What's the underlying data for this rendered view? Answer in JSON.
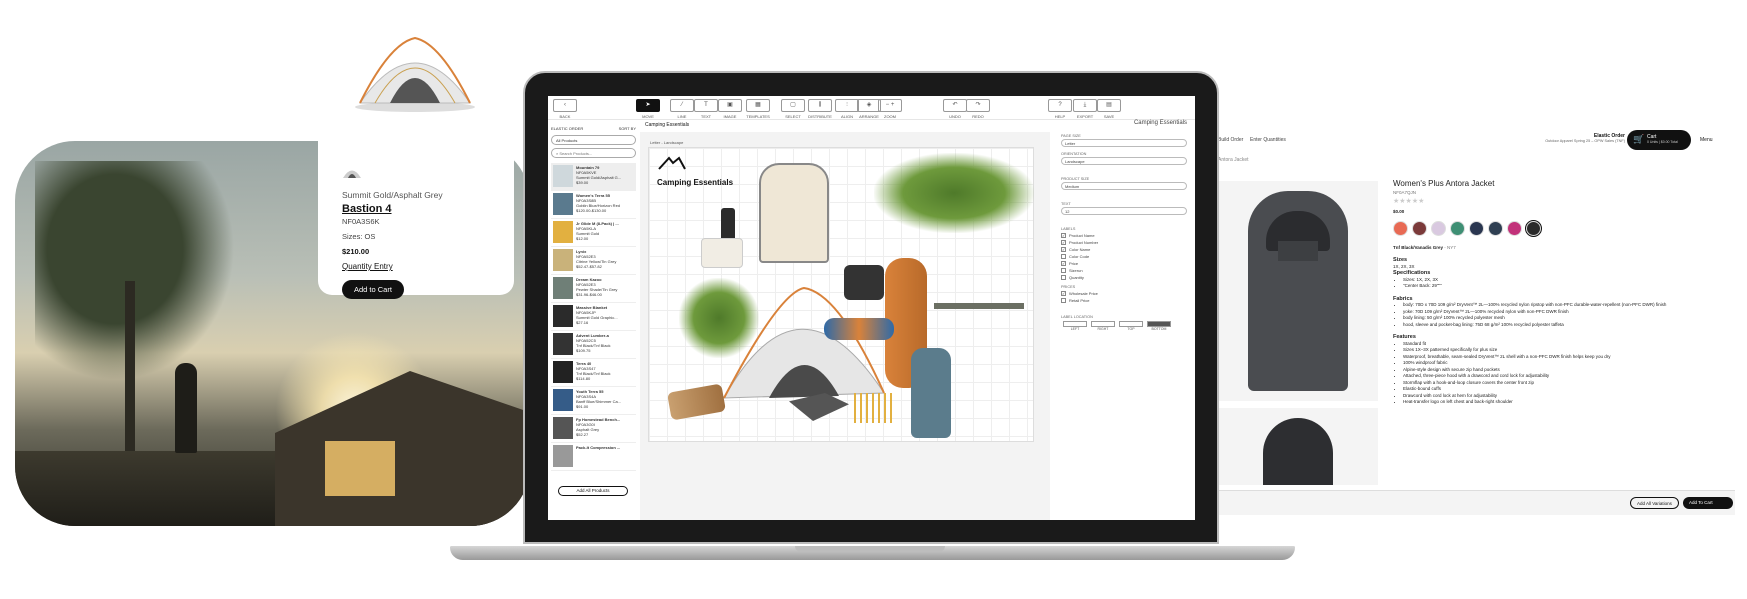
{
  "card": {
    "color": "Summit Gold/Asphalt Grey",
    "name": "Bastion 4",
    "sku": "NF0A3S6K",
    "sizes": "Sizes: OS",
    "price": "$210.00",
    "quantity_entry": "Quantity Entry",
    "add_to_cart": "Add to Cart"
  },
  "toolbar": {
    "items": [
      {
        "label": "BACK",
        "glyph": "‹"
      },
      {
        "label": "MOVE",
        "glyph": "➤"
      },
      {
        "label": "LINE",
        "glyph": "⁄"
      },
      {
        "label": "TEXT",
        "glyph": "T"
      },
      {
        "label": "IMAGE",
        "glyph": "▣"
      },
      {
        "label": "TEMPLATES",
        "glyph": "▦"
      },
      {
        "label": "SELECT",
        "glyph": "▢"
      },
      {
        "label": "DISTRIBUTE",
        "glyph": "⫼"
      },
      {
        "label": "ALIGN",
        "glyph": "⫶"
      },
      {
        "label": "ARRANGE",
        "glyph": "◈"
      },
      {
        "label": "ZOOM",
        "glyph": "−  +"
      },
      {
        "label": "UNDO",
        "glyph": "↶"
      },
      {
        "label": "REDO",
        "glyph": "↷"
      },
      {
        "label": "HELP",
        "glyph": "?"
      },
      {
        "label": "EXPORT",
        "glyph": "⤓"
      },
      {
        "label": "SAVE",
        "glyph": "▤"
      }
    ]
  },
  "sidebar": {
    "header_left": "ELASTIC ORDER",
    "header_right": "SORT BY",
    "filter": "All Products",
    "search_placeholder": "Search Products...",
    "items": [
      {
        "name": "Mountain 79",
        "sku": "NF0A5KVE",
        "color": "Summit Gold/Asphalt G...",
        "price": "$39.00"
      },
      {
        "name": "Women's Terra 55",
        "sku": "NF0A3S8B",
        "color": "Goblin Blue/Horizon Red",
        "price": "$120.00-$130.00"
      },
      {
        "name": "Jr Glide M (8-Pack) | ...",
        "sku": "NF0A5KLA",
        "color": "Summit Gold",
        "price": "$12.00"
      },
      {
        "name": "Lynix",
        "sku": "NF0A52E3",
        "color": "Citrine Yellow/Tin Grey",
        "price": "$52.47-$57.82"
      },
      {
        "name": "Dream Kazoo",
        "sku": "NF0A52E3",
        "color": "Pewter Shade/Tin Grey",
        "price": "$31.96-$46.00"
      },
      {
        "name": "Massive Blanket",
        "sku": "NF0A5KJP",
        "color": "Summit Gold Graphic...",
        "price": "$27.16"
      },
      {
        "name": "Advent Lumber-a",
        "sku": "NF0A52C5",
        "color": "Tnf Black/Tnf Black",
        "price": "$109.75"
      },
      {
        "name": "Terra 40",
        "sku": "NF0A3S47",
        "color": "Tnf Black/Tnf Black",
        "price": "$114.80"
      },
      {
        "name": "Youth Terra 55",
        "sku": "NF0A3S4A",
        "color": "Banff Blue/Shimmer Ca...",
        "price": "$91.00"
      },
      {
        "name": "Fp Homestead Bench...",
        "sku": "NF0A3G0I",
        "color": "Asphalt Grey",
        "price": "$52.27"
      },
      {
        "name": "Pack-It Compression ...",
        "sku": "",
        "color": "",
        "price": ""
      }
    ],
    "add_all": "Add All Products"
  },
  "canvas": {
    "tab": "Camping Essentials",
    "page_label": "Letter - Landscape",
    "brand_title": "Camping Essentials"
  },
  "settings": {
    "title": "Camping Essentials",
    "page_size_label": "PAGE SIZE",
    "page_size": "Letter",
    "orientation_label": "ORIENTATION",
    "orientation": "Landscape",
    "product_size_label": "PRODUCT SIZE",
    "product_size": "Medium",
    "text_label": "TEXT",
    "text": "12",
    "labels_label": "LABELS",
    "labels": [
      {
        "name": "Product Name",
        "checked": true
      },
      {
        "name": "Product Number",
        "checked": true
      },
      {
        "name": "Color Name",
        "checked": true
      },
      {
        "name": "Color Code",
        "checked": false
      },
      {
        "name": "Price",
        "checked": true
      },
      {
        "name": "Sizerun",
        "checked": false
      },
      {
        "name": "Quantity",
        "checked": false
      }
    ],
    "prices_label": "PRICES",
    "prices": [
      {
        "name": "Wholesale Price",
        "checked": true
      },
      {
        "name": "Retail Price",
        "checked": false
      }
    ],
    "location_label": "LABEL LOCATION",
    "locations": [
      "LEFT",
      "RIGHT",
      "TOP",
      "BOTTOM"
    ]
  },
  "product_page": {
    "tabs": [
      "Build Order",
      "Enter Quantities"
    ],
    "breadcrumb": "Antora Jacket",
    "order_title": "Elastic Order",
    "order_sub": "Outdoor Apparel Spring 25 – OPW Sales (TNF)",
    "cart_label": "Cart",
    "cart_sub": "0 Units | $0.00 Total",
    "menu": "Menu",
    "title": "Women's Plus Antora Jacket",
    "sku": "NF0A7QJN",
    "price": "$0.00",
    "color_name": "Tnf Black/Vanadis Grey",
    "color_code": "NY7",
    "swatches": [
      "#e86a54",
      "#7b3a3a",
      "#d9c9e0",
      "#3f8f74",
      "#2a3650",
      "#2f3f52",
      "#c2327a",
      "#2b2b2b"
    ],
    "sizes_h": "Sizes",
    "sizes": "1X, 2X, 3X",
    "spec_h": "Specifications",
    "specs": [
      "Sizes: 1X, 2X, 3X",
      "\"Center Back: 29\"\"\""
    ],
    "fabrics_h": "Fabrics",
    "fabrics": [
      "body: 70D x 70D 109 g/m² DryVent™ 2L—100% recycled nylon ripstop with non-PFC durable-water-repellent (non-PFC DWR) finish",
      "yoke: 70D 109 g/m² DryVent™ 2L—100% recycled nylon with non-PFC DWR finish",
      "body lining: 50 g/m² 100% recycled polyester mesh",
      "hood, sleeve and pocket-bag lining: 75D 68 g/m² 100% recycled polyester taffeta"
    ],
    "features_h": "Features",
    "features": [
      "Standard fit",
      "Sizes 1X–3X patterned specifically for plus size",
      "Waterproof, breathable, seam-sealed DryVent™ 2L shell with a non-PFC DWR finish helps keep you dry",
      "100% windproof fabric",
      "Alpine-style design with secure zip hand pockets",
      "Attached, three-piece hood with a drawcord and cord lock for adjustability",
      "Stormflap with a hook-and-loop closure covers the center front zip",
      "Elastic-bound cuffs",
      "Drawcord with cord lock at hem for adjustability",
      "Heat-transfer logo on left chest and back-right shoulder"
    ],
    "add_variations": "Add All Variations",
    "add_to_cart": "Add To Cart"
  },
  "colors": {
    "accent": "#111111",
    "page_bg": "#ffffff",
    "tent_orange": "#d9823a"
  }
}
